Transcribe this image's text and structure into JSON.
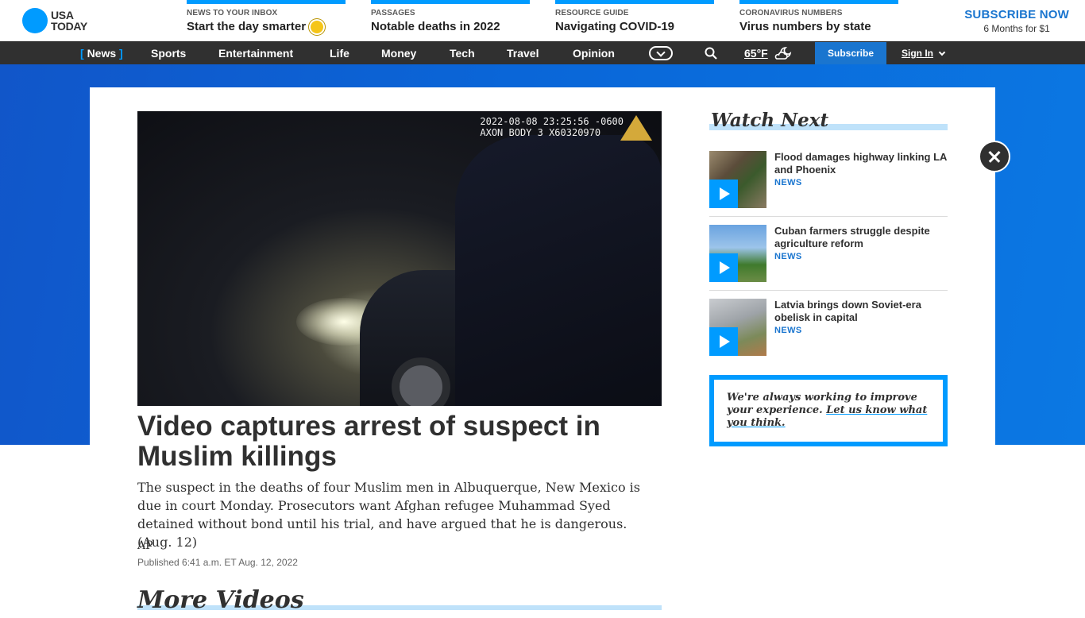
{
  "brand": {
    "line1": "USA",
    "line2": "TODAY"
  },
  "promos": [
    {
      "kicker": "NEWS TO YOUR INBOX",
      "headline": "Start the day smarter"
    },
    {
      "kicker": "PASSAGES",
      "headline": "Notable deaths in 2022"
    },
    {
      "kicker": "RESOURCE GUIDE",
      "headline": "Navigating COVID-19"
    },
    {
      "kicker": "CORONAVIRUS NUMBERS",
      "headline": "Virus numbers by state"
    }
  ],
  "subscribe_top": {
    "title": "SUBSCRIBE NOW",
    "offer": "6 Months for $1"
  },
  "nav": {
    "items": [
      "News",
      "Sports",
      "Entertainment",
      "Life",
      "Money",
      "Tech",
      "Travel",
      "Opinion"
    ],
    "active_open": "[",
    "active_close": "]",
    "weather_temp": "65°F",
    "subscribe_label": "Subscribe",
    "signin_label": "Sign In"
  },
  "video": {
    "stamp_line1": "2022-08-08 23:25:56 -0600",
    "stamp_line2": "AXON BODY 3 X60320970"
  },
  "article": {
    "headline": "Video captures arrest of suspect in Muslim killings",
    "dek": "The suspect in the deaths of four Muslim men in Albuquerque, New Mexico is due in court Monday. Prosecutors want Afghan refugee Muhammad Syed detained without bond until his trial, and have argued that he is dangerous. (Aug. 12)",
    "byline": "AP",
    "published": "Published 6:41 a.m. ET Aug. 12, 2022"
  },
  "more_videos": {
    "title": "More Videos"
  },
  "watch_next": {
    "title": "Watch Next",
    "items": [
      {
        "title": "Flood damages highway linking LA and Phoenix",
        "tag": "NEWS"
      },
      {
        "title": "Cuban farmers struggle despite agriculture reform",
        "tag": "NEWS"
      },
      {
        "title": "Latvia brings down Soviet-era obelisk in capital",
        "tag": "NEWS"
      }
    ]
  },
  "feedback": {
    "text": "We're always working to improve your experience. ",
    "link": "Let us know what you think."
  },
  "colors": {
    "accent": "#009bff",
    "brand_blue": "#1a75cf",
    "nav_bg": "#303030"
  }
}
